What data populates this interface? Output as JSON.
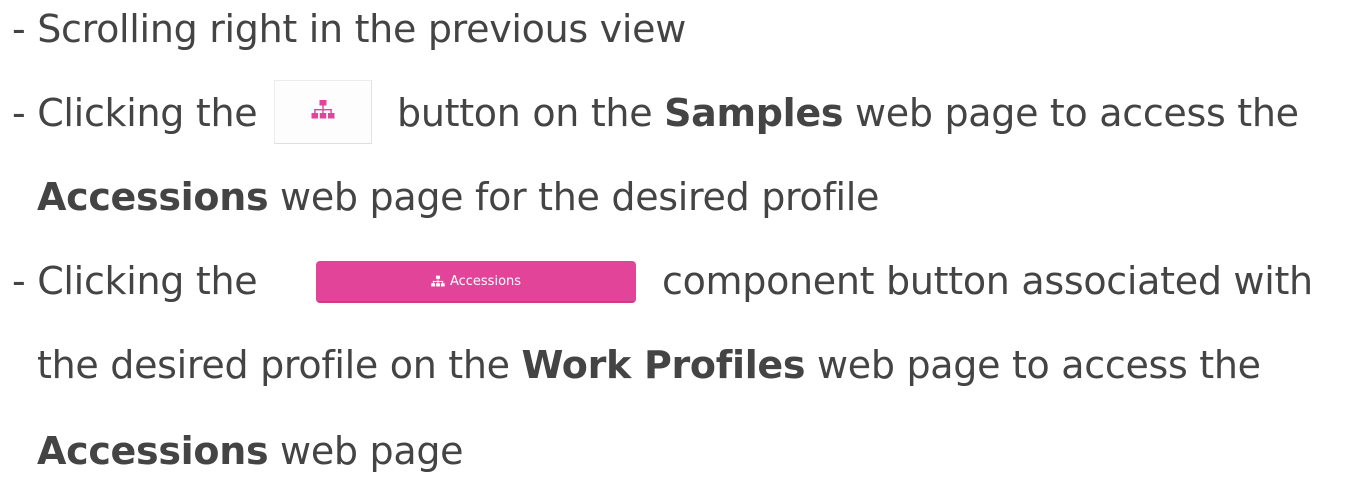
{
  "lines": {
    "line1": "- Scrolling right in the previous view",
    "line2_before": "- Clicking the",
    "line2_after_prefix": "button on the ",
    "line2_bold": "Samples",
    "line2_after_suffix": " web page to access the",
    "line3_bold": "Accessions",
    "line3_rest": " web page for the desired profile",
    "line4_before": "- Clicking the",
    "line4_after": "component button associated with",
    "line5_before": "the desired profile on the ",
    "line5_bold": "Work Profiles",
    "line5_after": " web page to access the",
    "line6_bold": "Accessions",
    "line6_rest": " web page"
  },
  "buttons": {
    "icon_button_icon": "sitemap-icon",
    "accessions_button_label": "Accessions",
    "accessions_button_icon": "sitemap-icon"
  },
  "colors": {
    "text": "#444444",
    "icon_pink": "#e2449a",
    "button_pink": "#e2449a"
  }
}
